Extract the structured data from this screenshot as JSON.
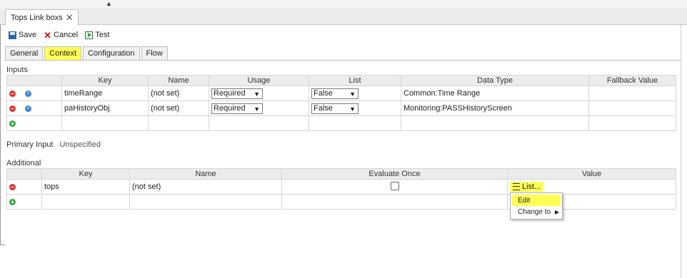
{
  "window": {
    "doc_tab_title": "Tops Link boxs",
    "close_glyph": "✕",
    "top_arrow": "▲"
  },
  "toolbar": {
    "save": "Save",
    "cancel": "Cancel",
    "test": "Test"
  },
  "subtabs": [
    {
      "label": "General",
      "active": false
    },
    {
      "label": "Context",
      "active": true
    },
    {
      "label": "Configuration",
      "active": false
    },
    {
      "label": "Flow",
      "active": false
    }
  ],
  "inputs": {
    "section_label": "Inputs",
    "columns": [
      "Key",
      "Name",
      "Usage",
      "List",
      "Data Type",
      "Fallback Value"
    ],
    "rows": [
      {
        "key": "timeRange",
        "name": "(not set)",
        "usage": "Required",
        "list": "False",
        "data_type": "Common:Time Range",
        "fallback": "",
        "move_icon": "move-down-icon",
        "move_glyph": "˅"
      },
      {
        "key": "paHistoryObj",
        "name": "(not set)",
        "usage": "Required",
        "list": "False",
        "data_type": "Monitoring:PASSHistoryScreen",
        "fallback": "",
        "move_icon": "move-up-icon",
        "move_glyph": "˄"
      }
    ]
  },
  "primary_input": {
    "label": "Primary Input",
    "value": "Unspecified"
  },
  "additional": {
    "section_label": "Additional",
    "columns": [
      "Key",
      "Name",
      "Evaluate Once",
      "Value"
    ],
    "rows": [
      {
        "key": "tops",
        "name": "(not set)",
        "evaluate_once": false,
        "value": "List..."
      }
    ]
  },
  "context_menu": {
    "items": [
      "Edit",
      "Change to"
    ],
    "highlighted": "Edit"
  },
  "colors": {
    "highlight": "#ffff55",
    "remove": "#e03030",
    "add": "#2fa83a",
    "move": "#3a86d0"
  }
}
